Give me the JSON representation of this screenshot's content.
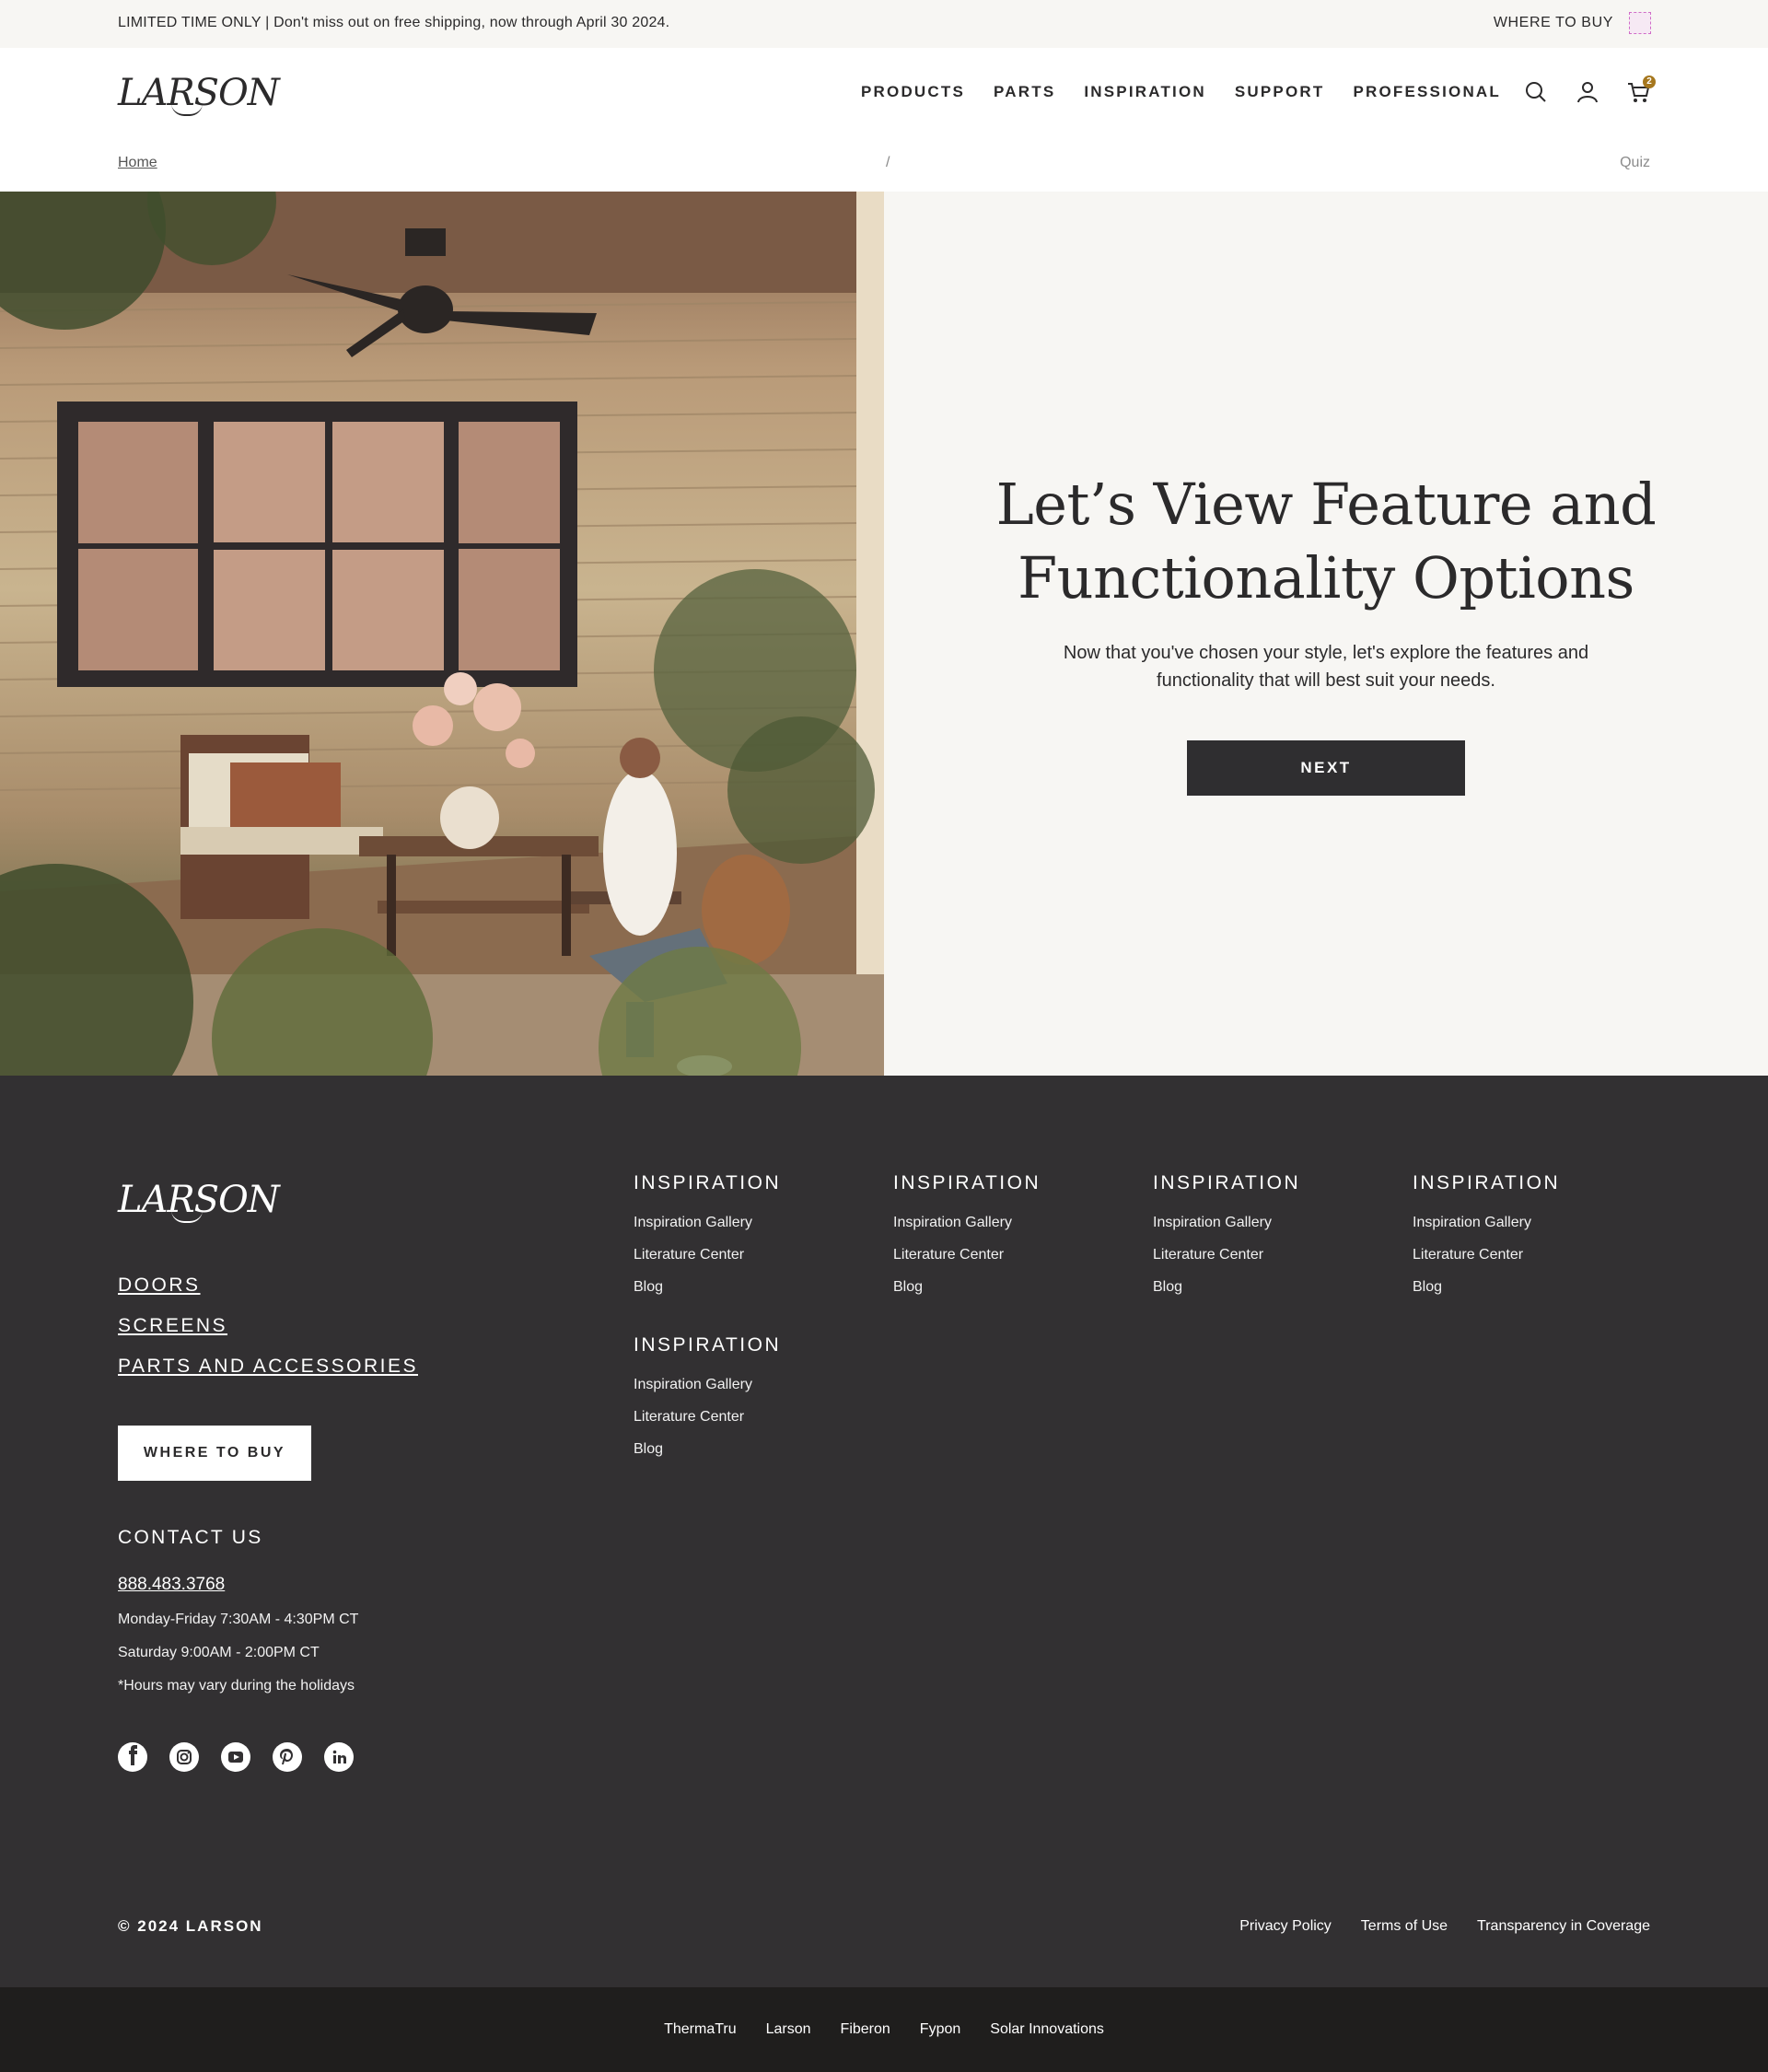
{
  "promo": {
    "message": "LIMITED TIME ONLY | Don't miss out on free shipping, now through April 30 2024.",
    "where_to_buy": "WHERE TO BUY",
    "flag_icon": "region-flag-icon"
  },
  "header": {
    "logo": "LARSON",
    "nav": [
      "PRODUCTS",
      "PARTS",
      "INSPIRATION",
      "SUPPORT",
      "PROFESSIONAL"
    ],
    "icons": [
      "search-icon",
      "account-icon",
      "cart-icon"
    ],
    "cart_count": "2"
  },
  "breadcrumb": {
    "home": "Home",
    "separator": "/",
    "current": "Quiz"
  },
  "hero": {
    "title_line1": "Let’s View Feature and",
    "title_line2": "Functionality Options",
    "subtitle": "Now that you've chosen your style, let's explore the features and functionality that will best suit your needs.",
    "next_label": "NEXT",
    "photo_alt": "Woman relaxing with coffee on a front porch"
  },
  "footer": {
    "logo": "LARSON",
    "categories": [
      "DOORS",
      "SCREENS",
      "PARTS AND ACCESSORIES"
    ],
    "where_to_buy": "WHERE TO BUY",
    "contact_heading": "CONTACT US",
    "phone": "888.483.3768",
    "hours": [
      "Monday-Friday 7:30AM - 4:30PM CT",
      "Saturday 9:00AM - 2:00PM CT",
      "*Hours may vary during the holidays"
    ],
    "socials": [
      "facebook-icon",
      "instagram-icon",
      "youtube-icon",
      "pinterest-icon",
      "linkedin-icon"
    ],
    "columns": [
      {
        "heading": "INSPIRATION",
        "links": [
          "Inspiration Gallery",
          "Literature Center",
          "Blog"
        ]
      },
      {
        "heading": "INSPIRATION",
        "links": [
          "Inspiration Gallery",
          "Literature Center",
          "Blog"
        ]
      },
      {
        "heading": "INSPIRATION",
        "links": [
          "Inspiration Gallery",
          "Literature Center",
          "Blog"
        ]
      },
      {
        "heading": "INSPIRATION",
        "links": [
          "Inspiration Gallery",
          "Literature Center",
          "Blog"
        ]
      },
      {
        "heading": "INSPIRATION",
        "links": [
          "Inspiration Gallery",
          "Literature Center",
          "Blog"
        ]
      }
    ],
    "copyright": "© 2024 LARSON",
    "legal": [
      "Privacy Policy",
      "Terms of Use",
      "Transparency in Coverage"
    ]
  },
  "brands": [
    "ThermaTru",
    "Larson",
    "Fiberon",
    "Fypon",
    "Solar Innovations"
  ],
  "colors": {
    "dark": "#2f2e30",
    "footer_bg": "#323032",
    "brandbar_bg": "#1f1e1d",
    "cream": "#f7f6f3",
    "accent_badge": "#a6771e"
  }
}
